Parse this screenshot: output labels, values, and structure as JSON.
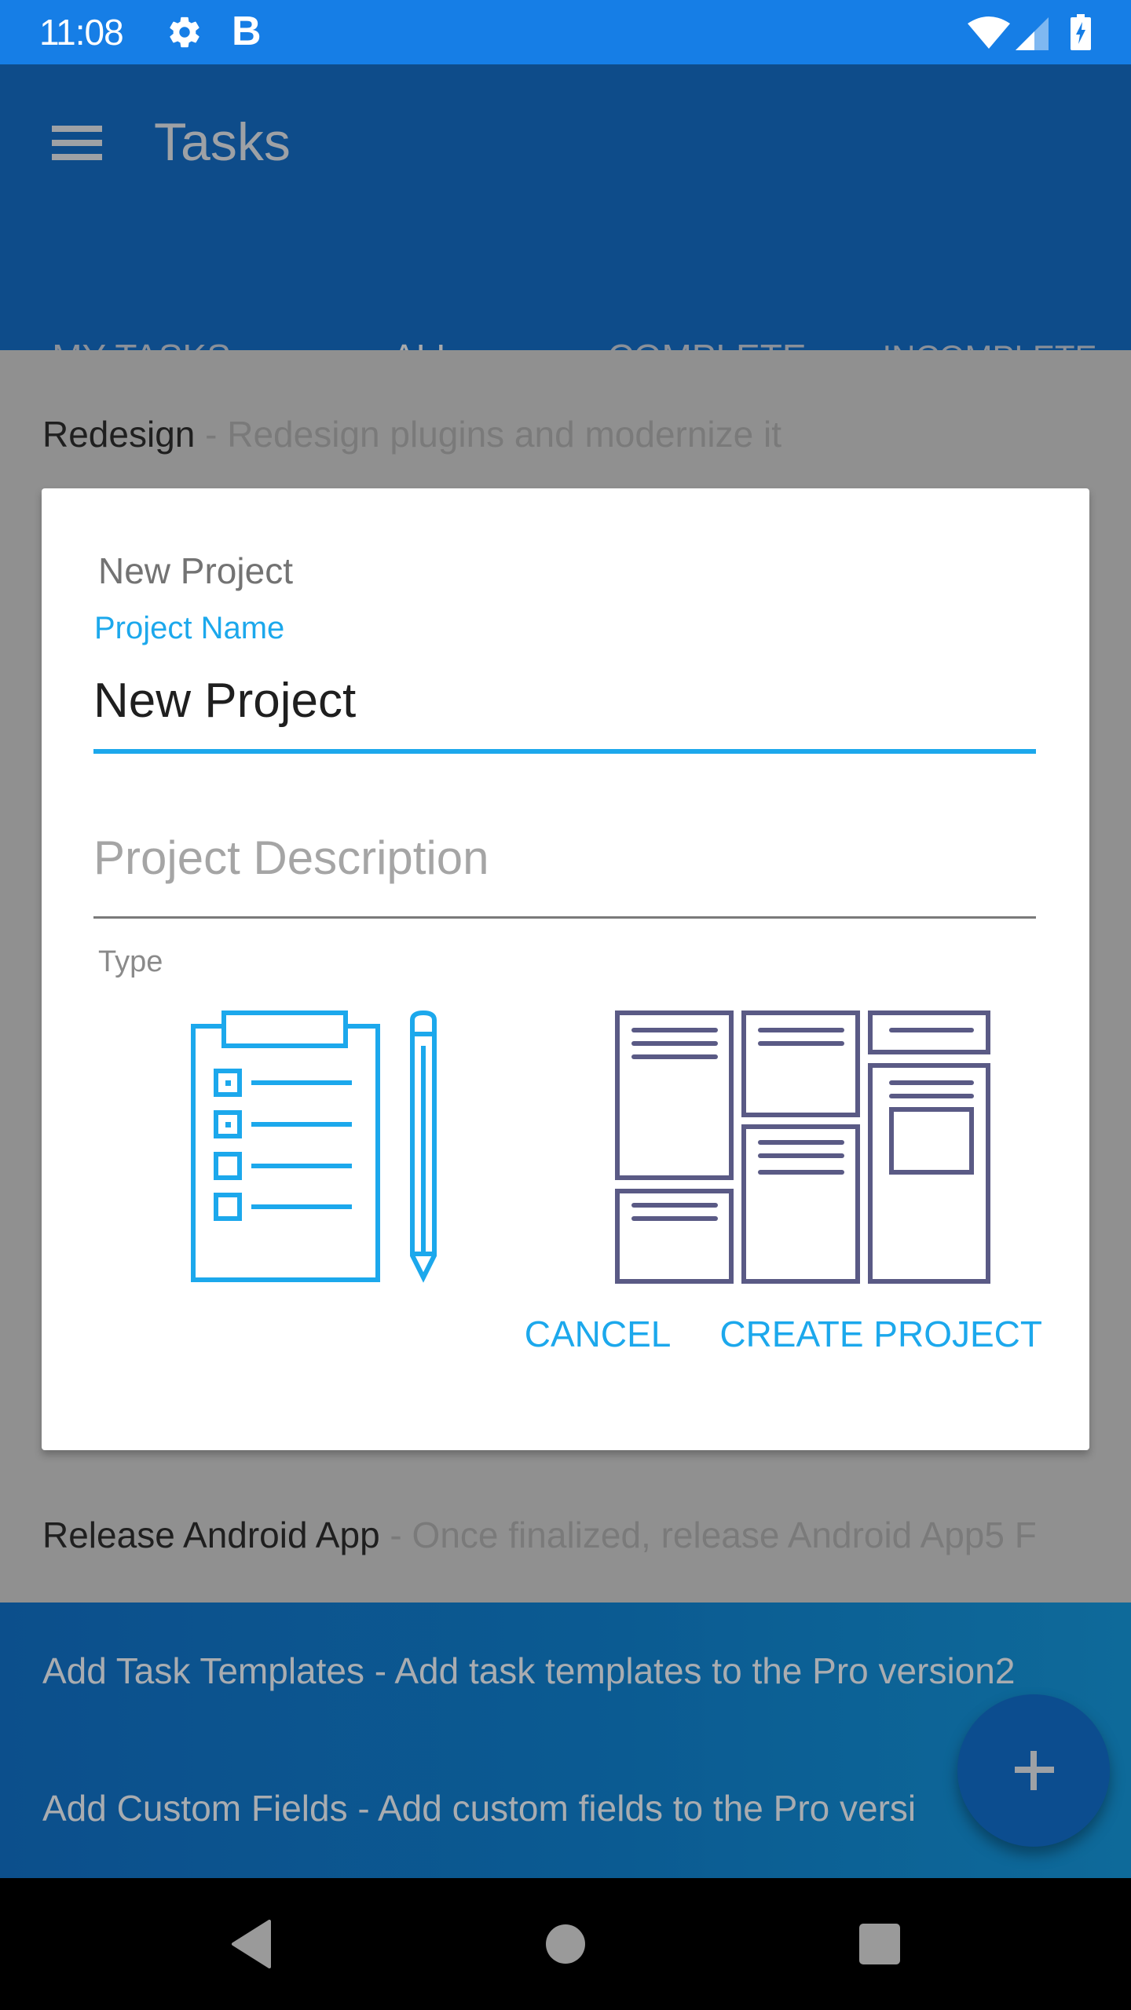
{
  "status_bar": {
    "time": "11:08",
    "notification_letter": "B",
    "icons": [
      "gear-icon",
      "wifi-icon",
      "signal-icon",
      "battery-charging-icon"
    ]
  },
  "toolbar": {
    "title": "Tasks",
    "menu_icon": "menu-icon"
  },
  "tabs": [
    {
      "label": "MY TASKS",
      "active": false
    },
    {
      "label": "ALL",
      "active": true
    },
    {
      "label": "COMPLETE",
      "active": false
    },
    {
      "label": "INCOMPLETE",
      "active": false
    }
  ],
  "tasks": [
    {
      "title": "Redesign",
      "separator": " - ",
      "description": "Redesign plugins and modernize it"
    },
    {
      "title": "Release Android App",
      "separator": " - ",
      "description": "Once finalized, release Android App5 F"
    }
  ],
  "promo_tasks": [
    {
      "text": "Add Task Templates - Add task templates to the Pro version2"
    },
    {
      "text": "Add Custom Fields - Add custom fields to the Pro versi"
    }
  ],
  "dialog": {
    "title": "New Project",
    "name_label": "Project Name",
    "name_value": "New Project",
    "description_placeholder": "Project Description",
    "description_value": "",
    "type_label": "Type",
    "type_options": [
      {
        "name": "checklist",
        "icon": "clipboard-checklist-icon"
      },
      {
        "name": "board",
        "icon": "kanban-board-icon"
      }
    ],
    "cancel_label": "CANCEL",
    "create_label": "CREATE PROJECT"
  },
  "fab": {
    "icon": "plus-icon"
  },
  "nav_bar": {
    "buttons": [
      "back",
      "home",
      "recents"
    ]
  },
  "colors": {
    "accent": "#1ca8ec",
    "primary": "#167ee6",
    "board_icon": "#5a5a85"
  }
}
